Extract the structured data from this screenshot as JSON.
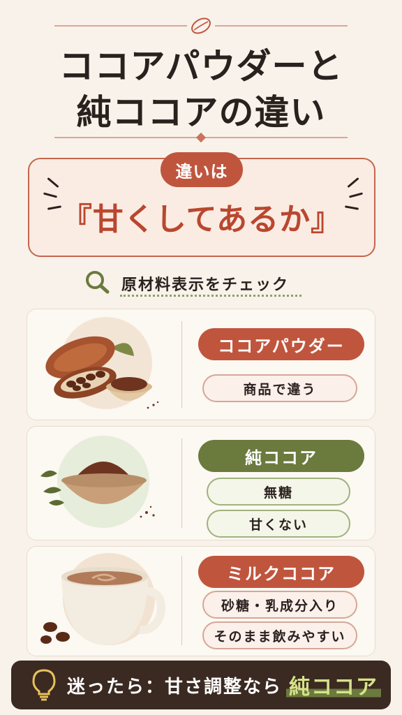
{
  "header": {
    "title_line1": "ココアパウダーと",
    "title_line2": "純ココアの違い",
    "ornament_icon": "cocoa-bean-icon"
  },
  "callout": {
    "badge": "違いは",
    "main": "『甘くしてあるか』"
  },
  "check": {
    "icon": "search-icon",
    "label": "原材料表示をチェック"
  },
  "cards": [
    {
      "image": "cocoa-pod-and-powder-bowl",
      "label": "ココアパウダー",
      "notes": [
        "商品で違う"
      ]
    },
    {
      "image": "pure-cocoa-powder-bowl",
      "label": "純ココア",
      "notes": [
        "無糖",
        "甘くない"
      ]
    },
    {
      "image": "milk-cocoa-cup",
      "label": "ミルクココア",
      "notes": [
        "砂糖・乳成分入り",
        "そのまま飲みやすい"
      ]
    }
  ],
  "footer": {
    "icon": "lightbulb-icon",
    "text": "迷ったら：甘さ調整なら",
    "highlight": "純ココア"
  },
  "colors": {
    "background": "#f8f2ea",
    "accent_red": "#c0553e",
    "accent_green": "#6b7a3d",
    "footer_bg": "#3a2a22",
    "highlight_text": "#d7e28a"
  }
}
